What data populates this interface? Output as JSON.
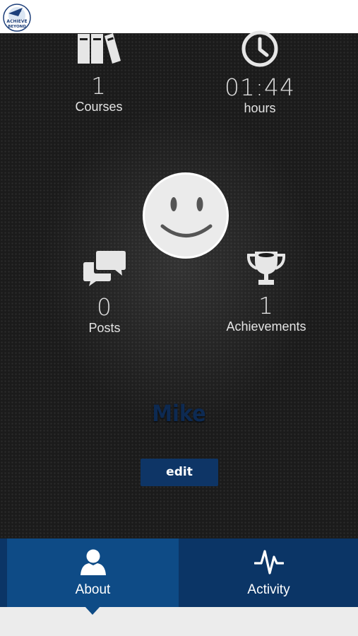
{
  "app": {
    "logo_icon": "achieve-beyond-logo"
  },
  "stats": {
    "courses": {
      "value": "1",
      "label": "Courses",
      "icon": "books-icon"
    },
    "hours": {
      "value": "01:44",
      "label": "hours",
      "icon": "clock-icon"
    },
    "posts": {
      "value": "0",
      "label": "Posts",
      "icon": "chat-bubbles-icon"
    },
    "achievements": {
      "value": "1",
      "label": "Achievements",
      "icon": "trophy-icon"
    }
  },
  "profile": {
    "avatar_icon": "smiley-face-icon",
    "name": "Mike",
    "edit_label": "edit"
  },
  "tabs": [
    {
      "label": "About",
      "icon": "person-icon",
      "active": true
    },
    {
      "label": "Activity",
      "icon": "pulse-icon",
      "active": false
    }
  ],
  "colors": {
    "panel_bg": "#1b1b1b",
    "tab_bar": "#0b3566",
    "tab_active": "#0e4b86",
    "edit_button": "#0e3566",
    "username": "#0d2a52"
  }
}
